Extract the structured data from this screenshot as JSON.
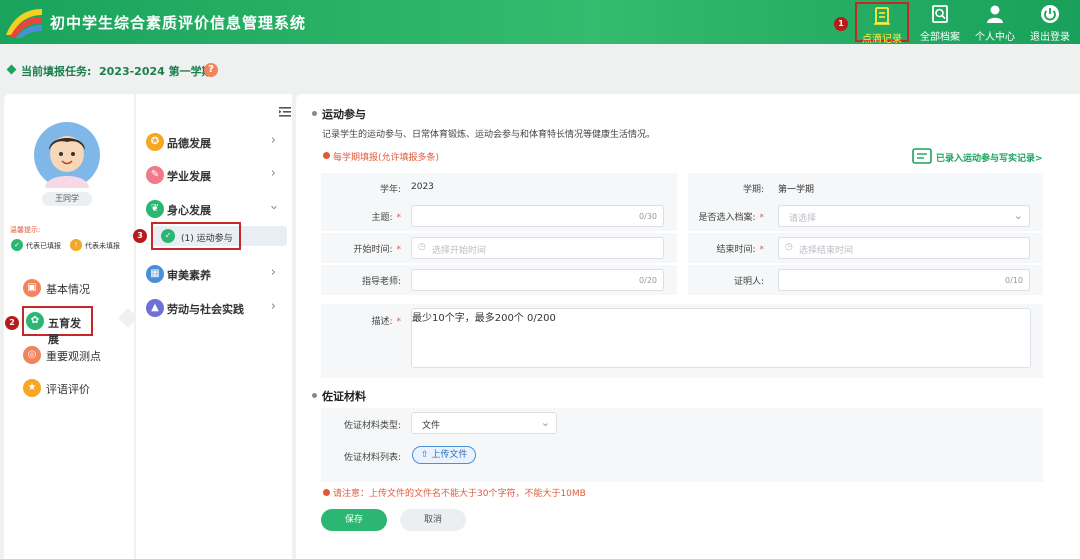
{
  "app": {
    "title": "初中学生综合素质评价信息管理系统"
  },
  "header": {
    "nav": [
      {
        "label": "点滴记录",
        "icon": "record-book-icon"
      },
      {
        "label": "全部档案",
        "icon": "archive-search-icon"
      },
      {
        "label": "个人中心",
        "icon": "user-icon"
      },
      {
        "label": "退出登录",
        "icon": "power-icon"
      }
    ],
    "steps": [
      "1",
      "2",
      "3"
    ]
  },
  "task": {
    "label": "当前填报任务:",
    "value": "2023-2024 第一学期",
    "help": "?"
  },
  "sidebar": {
    "user_name": "王同学",
    "tip_title": "温馨提示:",
    "tip_done": "代表已填报",
    "tip_todo": "代表未填报",
    "tip_todo_icon": "!",
    "items": [
      {
        "label": "基本情况",
        "icon": "profile-icon",
        "color": "#f0845c"
      },
      {
        "label": "五育发展",
        "icon": "flower-icon",
        "color": "#2bb673"
      },
      {
        "label": "重要观测点",
        "icon": "target-icon",
        "color": "#f0845c"
      },
      {
        "label": "评语评价",
        "icon": "award-icon",
        "color": "#f5a623"
      }
    ]
  },
  "categories": [
    {
      "label": "品德发展",
      "icon": "medal-icon",
      "color": "#f5a623"
    },
    {
      "label": "学业发展",
      "icon": "graduation-icon",
      "color": "#f07a8c"
    },
    {
      "label": "身心发展",
      "icon": "leaf-icon",
      "color": "#2bb673"
    },
    {
      "label": "审美素养",
      "icon": "art-icon",
      "color": "#4a90d9"
    },
    {
      "label": "劳动与社会实践",
      "icon": "cap-icon",
      "color": "#6f6fd8"
    }
  ],
  "sub_item": {
    "label": "(1) 运动参与"
  },
  "form": {
    "section_title": "运动参与",
    "description": "记录学生的运动参与、日常体育锻炼、运动会参与和体育特长情况等健康生活情况。",
    "note": "每学期填报(允许填报多条)",
    "records_link": "已录入运动参与写实记录>",
    "year_label": "学年:",
    "year_value": "2023",
    "term_label": "学期:",
    "term_value": "第一学期",
    "topic_label": "主题:",
    "topic_count": "0/30",
    "archive_label": "是否选入档案:",
    "archive_placeholder": "请选择",
    "start_label": "开始时间:",
    "start_placeholder": "选择开始时间",
    "end_label": "结束时间:",
    "end_placeholder": "选择结束时间",
    "teacher_label": "指导老师:",
    "teacher_count": "0/20",
    "witness_label": "证明人:",
    "witness_count": "0/10",
    "desc_label": "描述:",
    "desc_placeholder": "最少10个字，最多200个",
    "desc_count": "0/200",
    "required_mark": "*"
  },
  "evidence": {
    "section_title": "佐证材料",
    "type_label": "佐证材料类型:",
    "type_value": "文件",
    "list_label": "佐证材料列表:",
    "upload_label": "上传文件",
    "upload_icon_glyph": "⇧",
    "warning": "请注意：上传文件的文件名不能大于30个字符，不能大于10MB"
  },
  "actions": {
    "save": "保存",
    "cancel": "取消"
  }
}
